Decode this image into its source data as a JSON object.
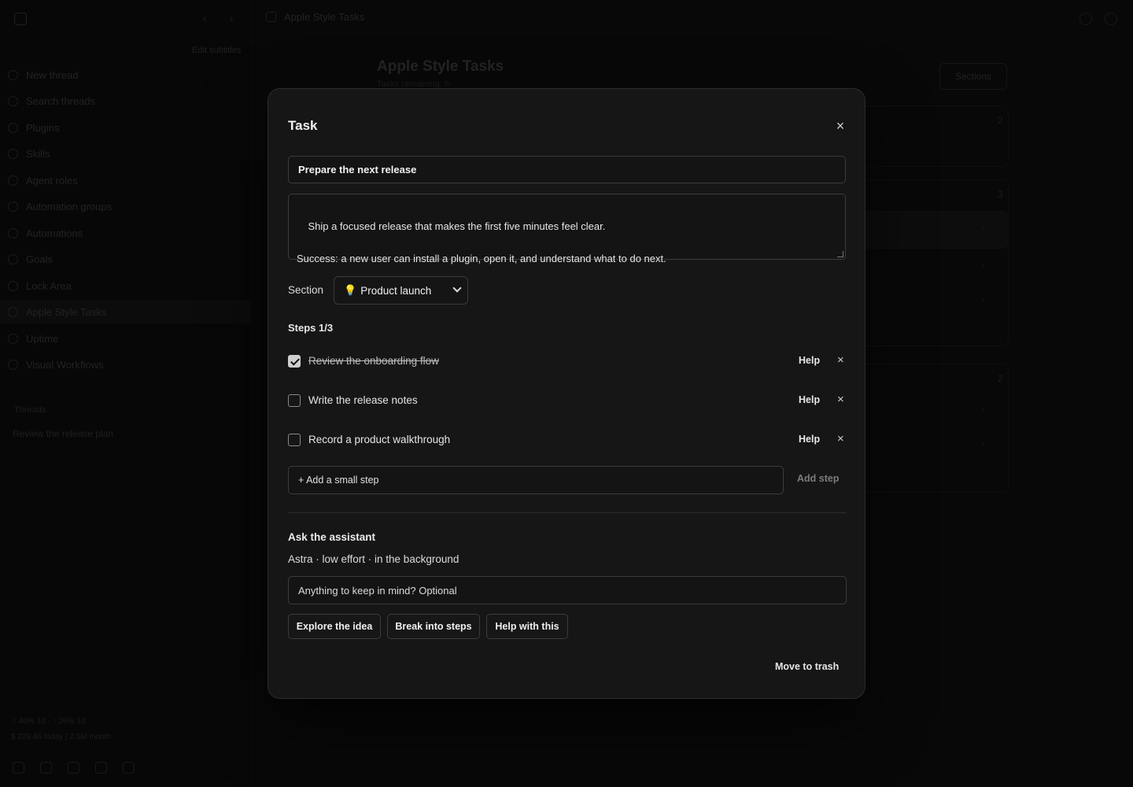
{
  "sidebar": {
    "edit_label": "Edit subtitles",
    "items": [
      {
        "label": "New thread",
        "icon": "edit-icon"
      },
      {
        "label": "Search threads",
        "icon": "search-icon"
      },
      {
        "label": "Plugins",
        "icon": "plugin-icon"
      },
      {
        "label": "Skills",
        "icon": "skill-icon"
      },
      {
        "label": "Agent roles",
        "icon": "person-icon"
      },
      {
        "label": "Automation groups",
        "icon": "group-icon"
      },
      {
        "label": "Automations",
        "icon": "clock-icon"
      },
      {
        "label": "Goals",
        "icon": "target-icon"
      },
      {
        "label": "Lock Area",
        "icon": "lock-icon"
      },
      {
        "label": "Apple Style Tasks",
        "icon": "tasks-icon",
        "active": true
      },
      {
        "label": "Uptime",
        "icon": "globe-icon"
      },
      {
        "label": "Visual Workflows",
        "icon": "workflow-icon"
      }
    ],
    "threads_label": "Threads",
    "thread_item": "Review the release plan",
    "usage_line1": "↑ 40% 1d · ↑ 26% 1d",
    "usage_line2": "$ 229.46 today | 2.5M month"
  },
  "main": {
    "breadcrumb": "Apple Style Tasks",
    "title": "Apple Style Tasks",
    "subtitle": "Tasks remaining: 6",
    "sections_button": "Sections",
    "counts": [
      "2",
      "3",
      "2"
    ]
  },
  "modal": {
    "title": "Task",
    "task_title": "Prepare the next release",
    "description": "Ship a focused release that makes the first five minutes feel clear.\n\nSuccess: a new user can install a plugin, open it, and understand what to do next.",
    "section_label": "Section",
    "section_value": "Product launch",
    "steps_heading": "Steps 1/3",
    "steps": [
      {
        "text": "Review the onboarding flow",
        "done": true
      },
      {
        "text": "Write the release notes",
        "done": false
      },
      {
        "text": "Record a product walkthrough",
        "done": false
      }
    ],
    "step_help_label": "Help",
    "add_step_placeholder": "+ Add a small step",
    "add_step_button": "Add step",
    "assistant_heading": "Ask the assistant",
    "assistant_sub": "Astra · low effort · in the background",
    "assistant_placeholder": "Anything to keep in mind? Optional",
    "actions": [
      "Explore the idea",
      "Break into steps",
      "Help with this"
    ],
    "trash_label": "Move to trash"
  }
}
